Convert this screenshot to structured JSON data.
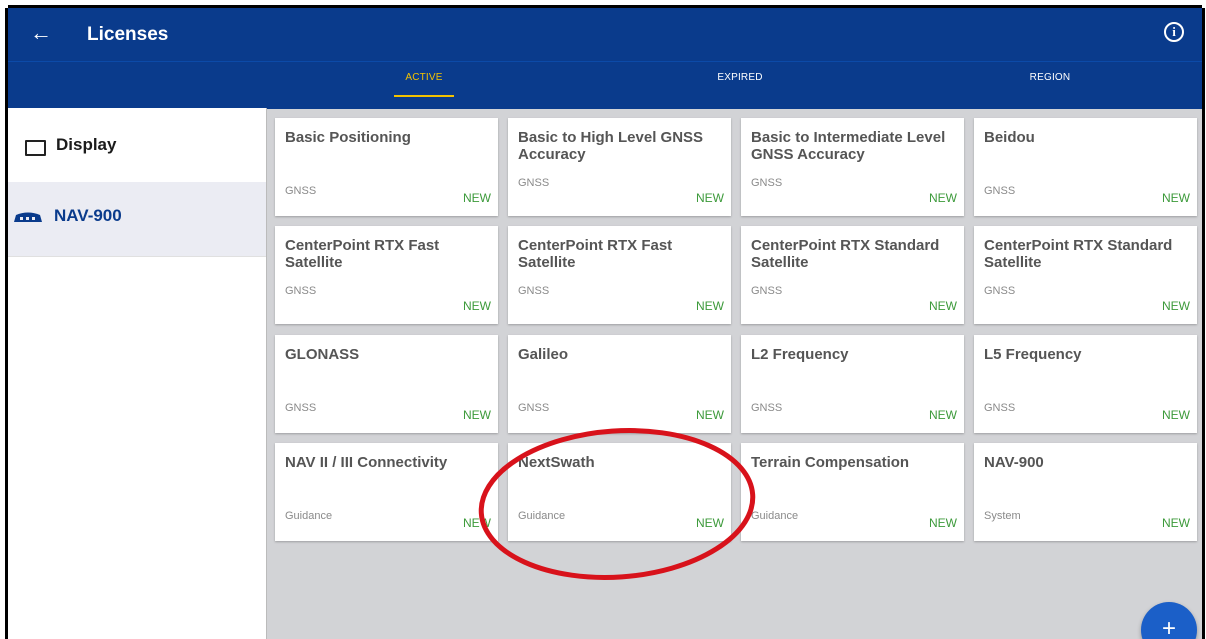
{
  "appbar": {
    "back_icon": "arrow-left-icon",
    "title": "Licenses",
    "info_icon": "info-icon",
    "info_glyph": "i"
  },
  "tabs": [
    {
      "label": "ACTIVE",
      "selected": true
    },
    {
      "label": "EXPIRED",
      "selected": false
    },
    {
      "label": "REGION",
      "selected": false
    }
  ],
  "sidebar": {
    "items": [
      {
        "label": "Display",
        "icon": "monitor-icon",
        "selected": false
      },
      {
        "label": "NAV-900",
        "icon": "receiver-icon",
        "selected": true
      }
    ]
  },
  "licenses": [
    {
      "title": "Basic Positioning",
      "category": "GNSS",
      "badge": "NEW"
    },
    {
      "title": "Basic to High Level GNSS Accuracy",
      "category": "GNSS",
      "badge": "NEW"
    },
    {
      "title": "Basic to Intermediate Level GNSS Accuracy",
      "category": "GNSS",
      "badge": "NEW"
    },
    {
      "title": "Beidou",
      "category": "GNSS",
      "badge": "NEW"
    },
    {
      "title": "CenterPoint RTX Fast Satellite",
      "category": "GNSS",
      "badge": "NEW"
    },
    {
      "title": "CenterPoint RTX Fast Satellite",
      "category": "GNSS",
      "badge": "NEW"
    },
    {
      "title": "CenterPoint RTX Standard Satellite",
      "category": "GNSS",
      "badge": "NEW"
    },
    {
      "title": "CenterPoint RTX Standard Satellite",
      "category": "GNSS",
      "badge": "NEW"
    },
    {
      "title": "GLONASS",
      "category": "GNSS",
      "badge": "NEW"
    },
    {
      "title": "Galileo",
      "category": "GNSS",
      "badge": "NEW"
    },
    {
      "title": "L2 Frequency",
      "category": "GNSS",
      "badge": "NEW"
    },
    {
      "title": "L5 Frequency",
      "category": "GNSS",
      "badge": "NEW"
    },
    {
      "title": "NAV II / III Connectivity",
      "category": "Guidance",
      "badge": "NEW"
    },
    {
      "title": "NextSwath",
      "category": "Guidance",
      "badge": "NEW"
    },
    {
      "title": "Terrain Compensation",
      "category": "Guidance",
      "badge": "NEW"
    },
    {
      "title": "NAV-900",
      "category": "System",
      "badge": "NEW"
    }
  ],
  "annotation": {
    "shape": "ellipse",
    "color": "#d8121b",
    "target": "NextSwath"
  },
  "fab": {
    "icon": "plus-icon",
    "glyph": "+"
  },
  "colors": {
    "appbar": "#0a3b8c",
    "tab_active": "#f3c200",
    "badge_new": "#3c9a3a",
    "fab": "#1b5fc8",
    "background": "#d2d3d6"
  }
}
